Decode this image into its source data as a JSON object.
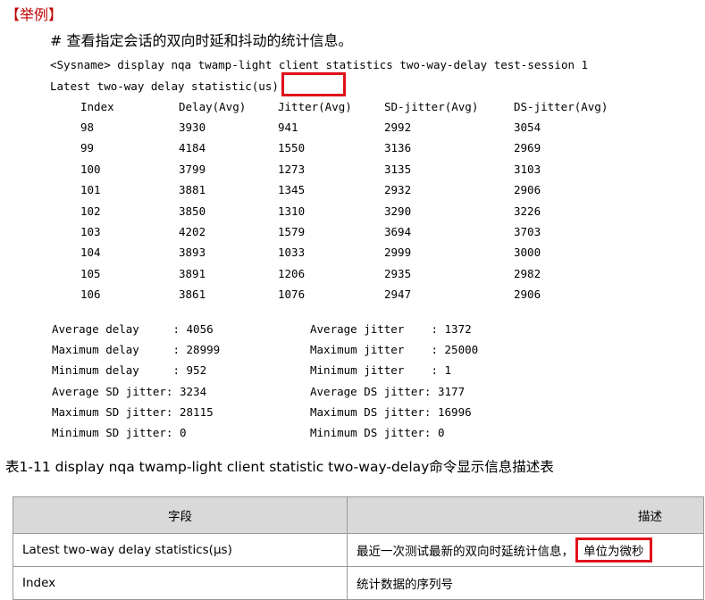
{
  "heading": "【举例】",
  "subtitle": "# 查看指定会话的双向时延和抖动的统计信息。",
  "command": "<Sysname> display nqa twamp-light client statistics two-way-delay test-session 1",
  "latest_line": "Latest two-way delay statistic",
  "latest_unit": "(us):",
  "stats_table": {
    "headers": [
      "Index",
      "Delay(Avg)",
      "Jitter(Avg)",
      "SD-jitter(Avg)",
      "DS-jitter(Avg)"
    ],
    "rows": [
      [
        "98",
        "3930",
        "941",
        "2992",
        "3054"
      ],
      [
        "99",
        "4184",
        "1550",
        "3136",
        "2969"
      ],
      [
        "100",
        "3799",
        "1273",
        "3135",
        "3103"
      ],
      [
        "101",
        "3881",
        "1345",
        "2932",
        "2906"
      ],
      [
        "102",
        "3850",
        "1310",
        "3290",
        "3226"
      ],
      [
        "103",
        "4202",
        "1579",
        "3694",
        "3703"
      ],
      [
        "104",
        "3893",
        "1033",
        "2999",
        "3000"
      ],
      [
        "105",
        "3891",
        "1206",
        "2935",
        "2982"
      ],
      [
        "106",
        "3861",
        "1076",
        "2947",
        "2906"
      ]
    ]
  },
  "summary_left": [
    "Average delay     : 4056",
    "Maximum delay     : 28999",
    "Minimum delay     : 952",
    "Average SD jitter: 3234",
    "Maximum SD jitter: 28115",
    "Minimum SD jitter: 0"
  ],
  "summary_right": [
    "Average jitter    : 1372",
    "Maximum jitter    : 25000",
    "Minimum jitter    : 1",
    "Average DS jitter: 3177",
    "Maximum DS jitter: 16996",
    "Minimum DS jitter: 0"
  ],
  "caption": "表1-11 display nqa twamp-light client statistic two-way-delay命令显示信息描述表",
  "desc_table": {
    "headers": [
      "字段",
      "描述"
    ],
    "rows": [
      {
        "field": "Latest two-way delay statistics(μs)",
        "desc": "最近一次测试最新的双向时延统计信息，",
        "highlight": "单位为微秒"
      },
      {
        "field": "Index",
        "desc": "统计数据的序列号",
        "highlight": ""
      }
    ]
  },
  "colors": {
    "heading": "#c00000",
    "highlight_border": "#e0101a",
    "table_header_bg": "#d9d9d9"
  }
}
